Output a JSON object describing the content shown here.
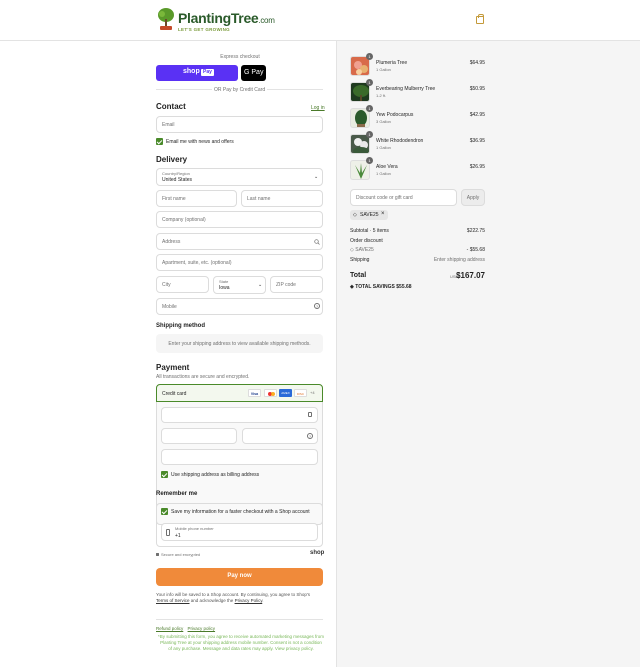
{
  "brand": {
    "name": "PlantingTree",
    "domain": ".com",
    "tagline": "LET'S GET GROWING"
  },
  "express": {
    "label": "Express checkout",
    "shop_pay_label": "shop",
    "shop_pay_badge": "Pay",
    "gpay_label": "G Pay",
    "divider": "OR Pay by Credit Card"
  },
  "contact": {
    "title": "Contact",
    "login": "Log in",
    "email_placeholder": "Email",
    "news_label": "Email me with news and offers"
  },
  "delivery": {
    "title": "Delivery",
    "country_label": "Country/Region",
    "country_value": "United States",
    "first_name": "First name",
    "last_name": "Last name",
    "company": "Company (optional)",
    "address": "Address",
    "apartment": "Apartment, suite, etc. (optional)",
    "city": "City",
    "state_label": "State",
    "state_value": "Iowa",
    "zip": "ZIP code",
    "mobile": "Mobile"
  },
  "shipping": {
    "title": "Shipping method",
    "notice": "Enter your shipping address to view available shipping methods."
  },
  "payment": {
    "title": "Payment",
    "subtitle": "All transactions are secure and encrypted.",
    "credit_card": "Credit card",
    "card_brands": [
      "Visa",
      "MC",
      "AMEX",
      "DISC"
    ],
    "more_brands": "+4",
    "billing_label": "Use shipping address as billing address"
  },
  "remember": {
    "title": "Remember me",
    "save_label": "Save my information for a faster checkout with a Shop account",
    "phone_label": "Mobile phone number",
    "phone_value": "+1",
    "secure": "Secure and encrypted",
    "shop_logo": "shop"
  },
  "pay_now": "Pay now",
  "terms": {
    "prefix": "Your info will be saved to a Shop account. By continuing, you agree to Shop's",
    "tos": "Terms of Service",
    "middle": " and acknowledge the ",
    "privacy": "Privacy Policy",
    "suffix": "."
  },
  "footer": {
    "refund": "Refund policy",
    "privacy": "Privacy policy",
    "disclaimer_1": "*By submitting this form, you agree to receive automated marketing messages from",
    "disclaimer_2": "Planting Tree at your shipping address mobile number. Consent is not a condition",
    "disclaimer_3": "of any purchase. Message and data rates may apply. View privacy policy."
  },
  "cart": {
    "items": [
      {
        "name": "Plumeria Tree",
        "sub": "1 Gallon",
        "price": "$64.95",
        "qty": "1",
        "color": "#c0503a"
      },
      {
        "name": "Everbearing Mulberry Tree",
        "sub": "1-2 ft.",
        "price": "$50.95",
        "qty": "1",
        "color": "#2a4a2a"
      },
      {
        "name": "Yew Podocarpus",
        "sub": "3 Gallon",
        "price": "$42.95",
        "qty": "1",
        "color": "#3a6a3a"
      },
      {
        "name": "White Rhododendron",
        "sub": "1 Gallon",
        "price": "$36.95",
        "qty": "1",
        "color": "#8a9a8a"
      },
      {
        "name": "Aloe Vera",
        "sub": "1 Gallon",
        "price": "$26.95",
        "qty": "1",
        "color": "#5a8a4a"
      }
    ],
    "discount_placeholder": "Discount code or gift card",
    "apply": "Apply",
    "code": "SAVE25",
    "subtotal_label": "Subtotal · 5 items",
    "subtotal": "$222.75",
    "order_discount_label": "Order discount",
    "order_discount_code": "SAVE25",
    "order_discount": "- $55.68",
    "shipping_label": "Shipping",
    "shipping_value": "Enter shipping address",
    "total_label": "Total",
    "currency": "USD",
    "total": "$167.07",
    "savings_label": "TOTAL SAVINGS",
    "savings": "$55.68"
  },
  "colors": {
    "accent": "#4a8a2a",
    "shop_pay": "#5a31f4",
    "pay_now": "#f08a3a",
    "summary_bg": "#f5f5f5"
  }
}
